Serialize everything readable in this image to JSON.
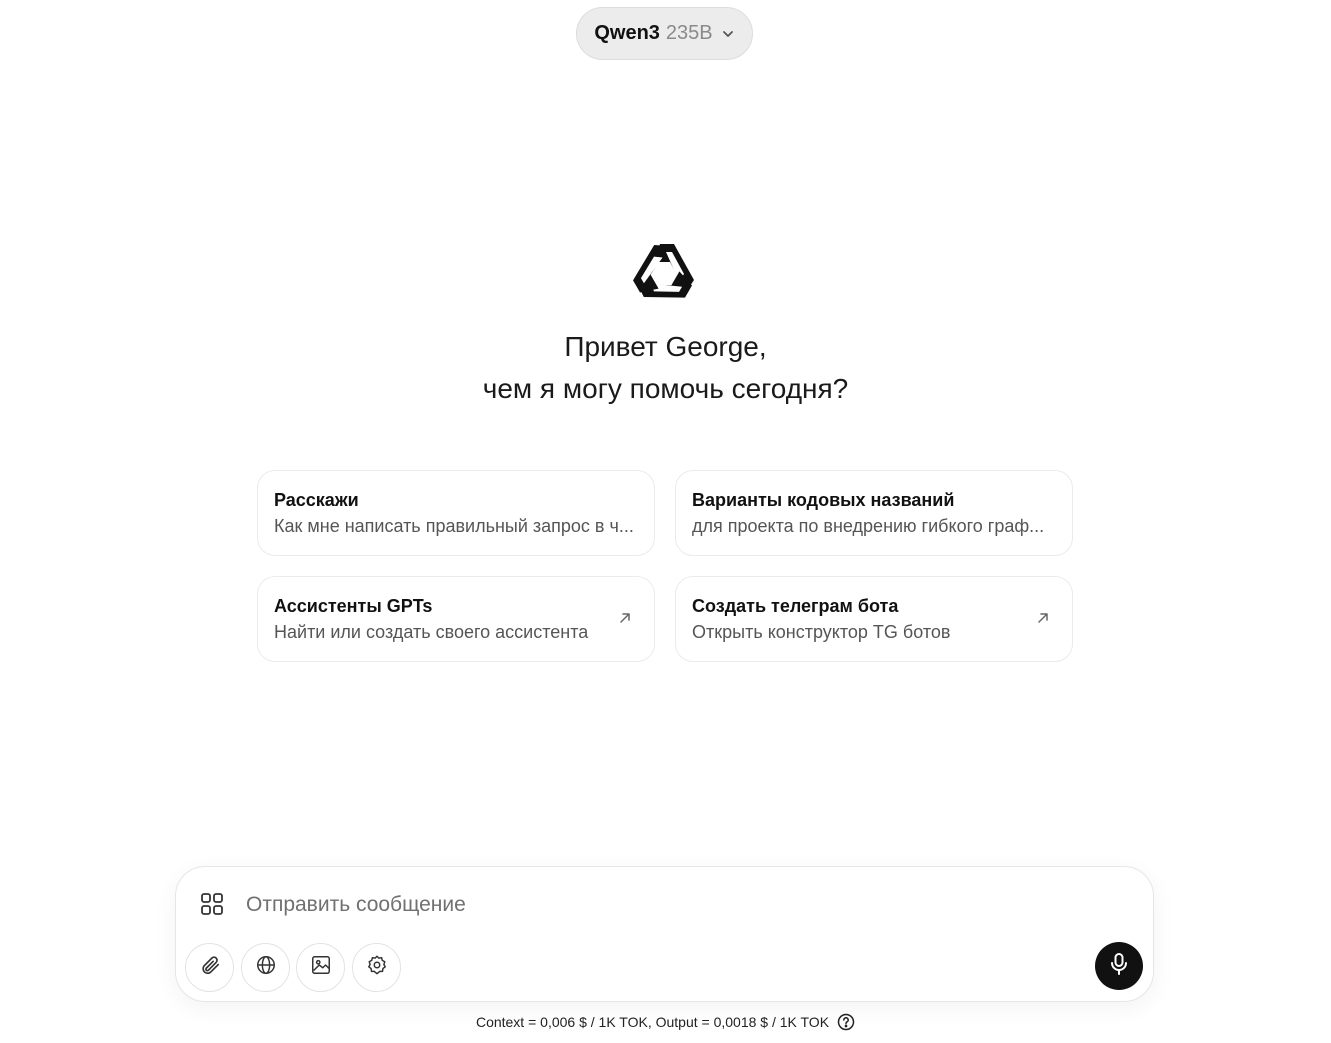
{
  "model": {
    "name": "Qwen3",
    "size": "235B"
  },
  "greeting": {
    "line1": "Привет George,",
    "line2": "чем я могу помочь сегодня?"
  },
  "suggestions": [
    {
      "title": "Расскажи",
      "subtitle": "Как мне написать правильный запрос в ч..."
    },
    {
      "title": "Варианты кодовых названий",
      "subtitle": "для проекта по внедрению гибкого граф..."
    },
    {
      "title": "Ассистенты GPTs",
      "subtitle": "Найти или создать своего ассистента",
      "icon": "arrow-up-right-icon"
    },
    {
      "title": "Создать телеграм бота",
      "subtitle": "Открыть конструктор TG ботов",
      "icon": "arrow-up-right-icon"
    }
  ],
  "composer": {
    "placeholder": "Отправить сообщение",
    "tools": [
      "paperclip-icon",
      "globe-icon",
      "image-icon",
      "gear-icon"
    ],
    "send": "microphone-icon"
  },
  "footer": {
    "pricing": "Context = 0,006 $ / 1K TOK, Output = 0,0018 $ / 1K TOK"
  }
}
